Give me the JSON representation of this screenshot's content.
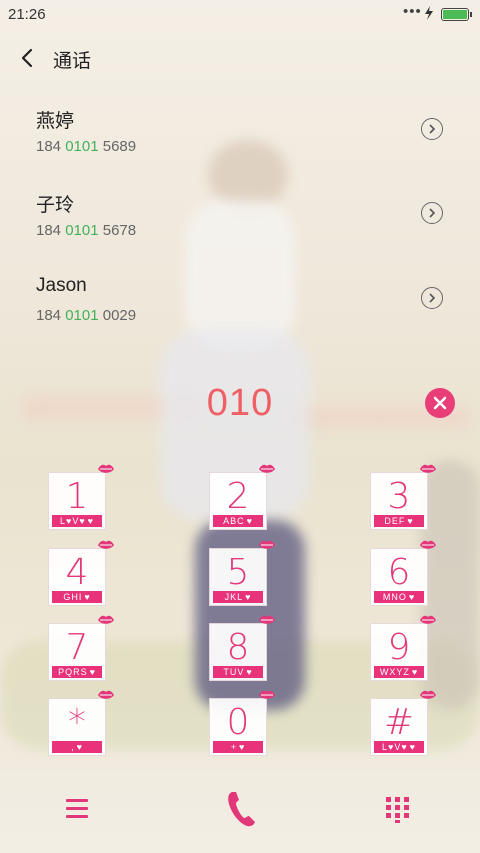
{
  "status_bar": {
    "time": "21:26",
    "dots": "•••"
  },
  "header": {
    "title": "通话"
  },
  "contacts": [
    {
      "name": "燕婷",
      "num_pre": "184 ",
      "num_hl": "0101",
      "num_post": " 5689"
    },
    {
      "name": "子玲",
      "num_pre": "184 ",
      "num_hl": "0101",
      "num_post": " 5678"
    },
    {
      "name": "Jason",
      "num_pre": "184 ",
      "num_hl": "0101",
      "num_post": " 0029"
    }
  ],
  "dial": {
    "value": "010"
  },
  "keys": [
    {
      "digit": "1",
      "letters": "L♥V♥"
    },
    {
      "digit": "2",
      "letters": "ABC"
    },
    {
      "digit": "3",
      "letters": "DEF"
    },
    {
      "digit": "4",
      "letters": "GHI"
    },
    {
      "digit": "5",
      "letters": "JKL"
    },
    {
      "digit": "6",
      "letters": "MNO"
    },
    {
      "digit": "7",
      "letters": "PQRS"
    },
    {
      "digit": "8",
      "letters": "TUV"
    },
    {
      "digit": "9",
      "letters": "WXYZ"
    },
    {
      "digit": "*",
      "letters": ","
    },
    {
      "digit": "0",
      "letters": "+"
    },
    {
      "digit": "#",
      "letters": "L♥V♥"
    }
  ],
  "colors": {
    "accent": "#e2387a",
    "highlight": "#43b05c",
    "input": "#ef5f66"
  }
}
